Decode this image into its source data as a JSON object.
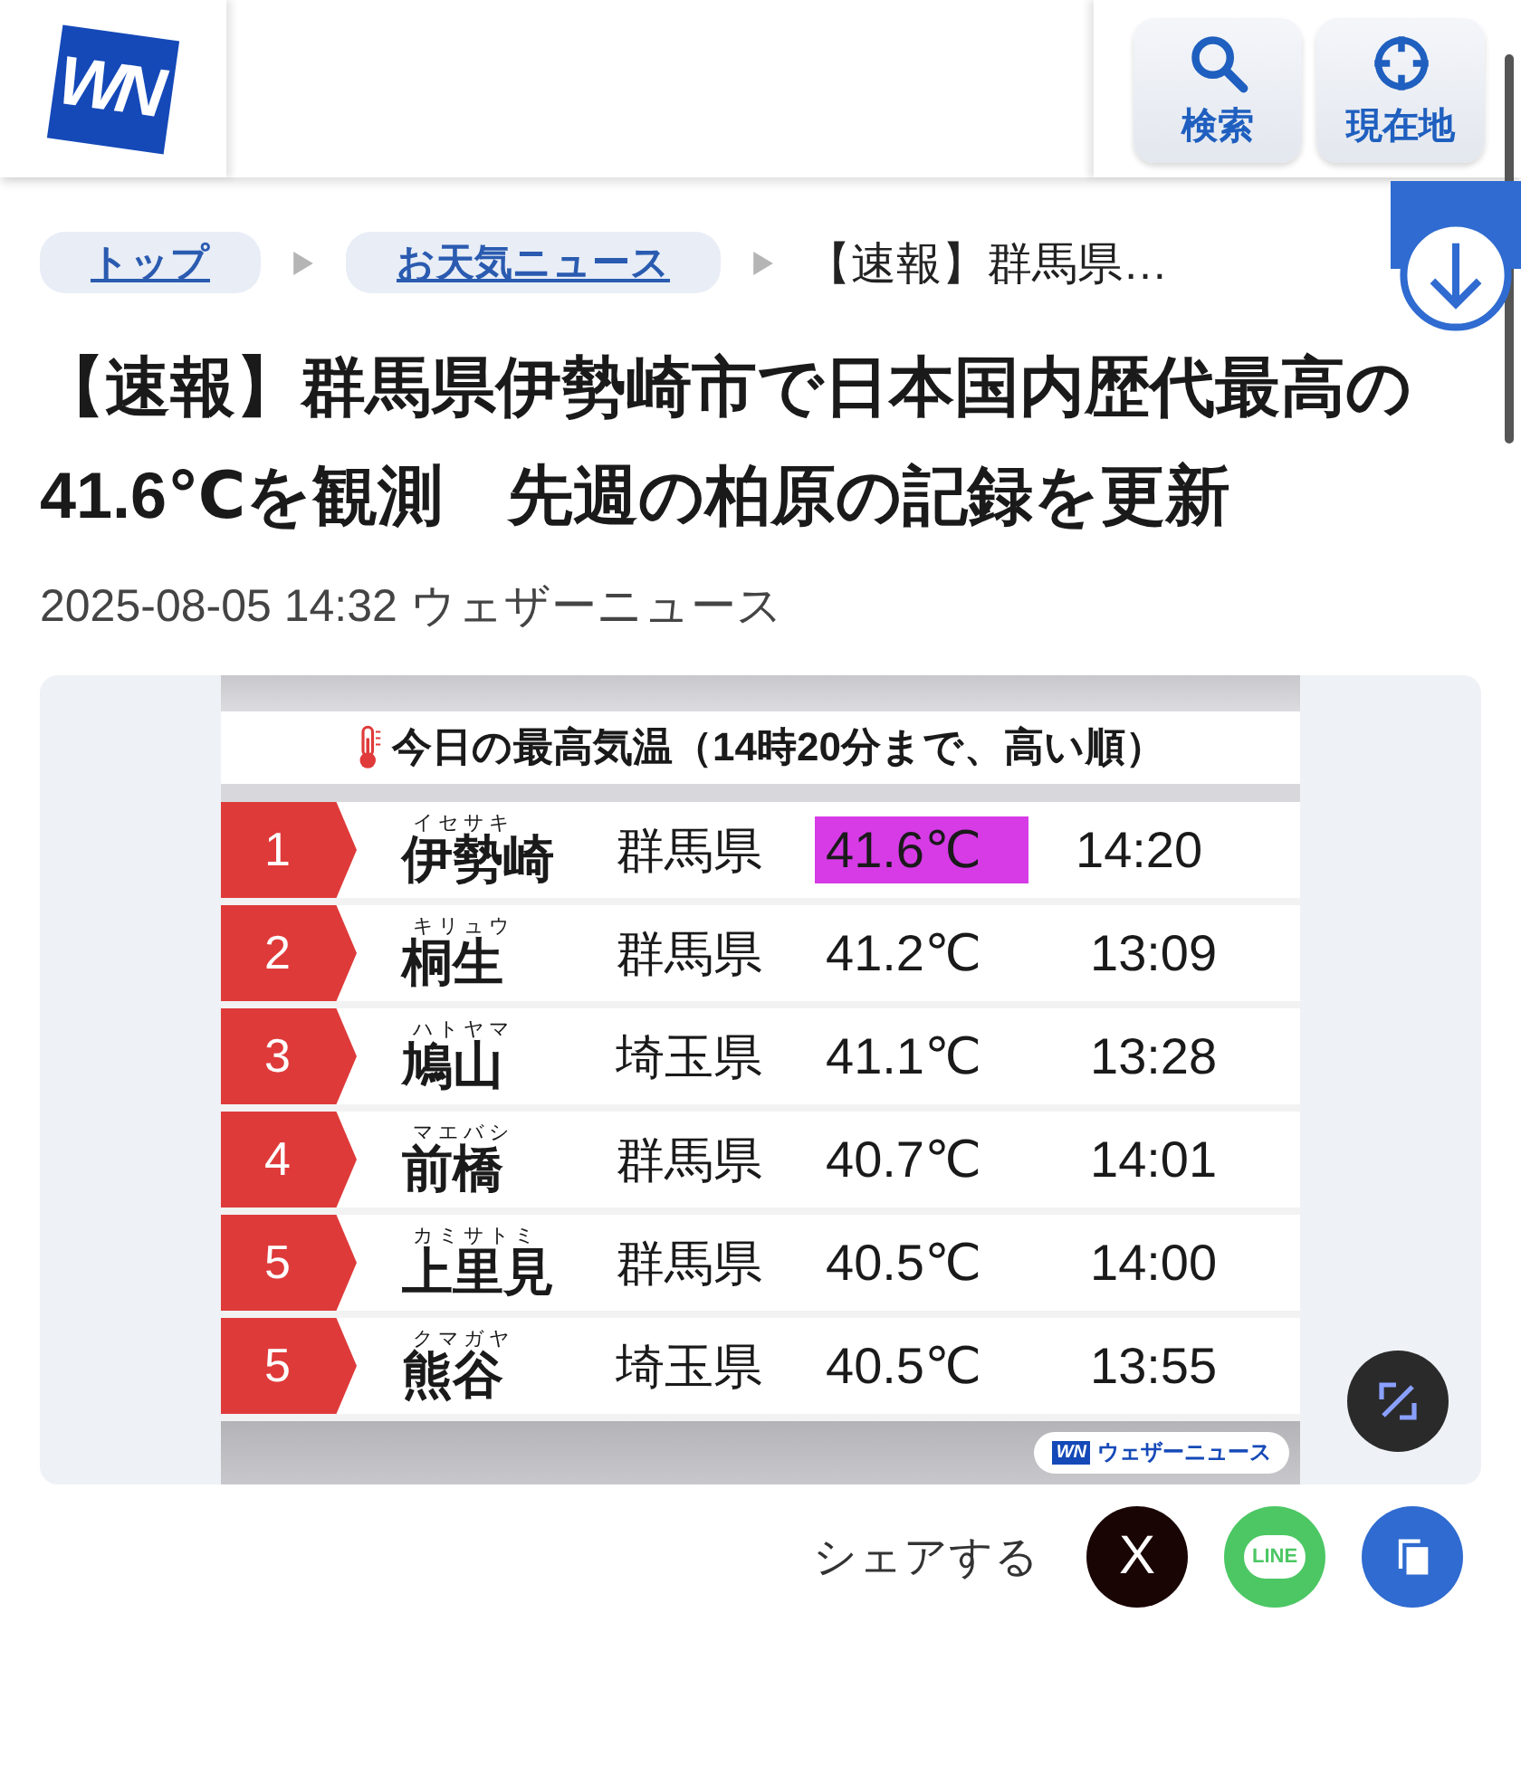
{
  "header": {
    "logo_text": "WN",
    "buttons": [
      {
        "kind": "search",
        "label": "検索"
      },
      {
        "kind": "location",
        "label": "現在地"
      }
    ]
  },
  "breadcrumb": [
    {
      "label": "トップ",
      "link": true
    },
    {
      "label": "お天気ニュース",
      "link": true
    },
    {
      "label": "【速報】群馬県…",
      "link": false
    }
  ],
  "article": {
    "title": "【速報】群馬県伊勢崎市で日本国内歴代最高の41.6℃を観測　先週の柏原の記録を更新",
    "meta": "2025-08-05 14:32 ウェザーニュース"
  },
  "figure": {
    "heading": "今日の最高気温（14時20分まで、高い順）",
    "rows": [
      {
        "rank": "1",
        "reading": "イセサキ",
        "name": "伊勢崎",
        "prefecture": "群馬県",
        "temperature": "41.6℃",
        "time": "14:20",
        "highlighted": true
      },
      {
        "rank": "2",
        "reading": "キリュウ",
        "name": "桐生",
        "prefecture": "群馬県",
        "temperature": "41.2℃",
        "time": "13:09",
        "highlighted": false
      },
      {
        "rank": "3",
        "reading": "ハトヤマ",
        "name": "鳩山",
        "prefecture": "埼玉県",
        "temperature": "41.1℃",
        "time": "13:28",
        "highlighted": false
      },
      {
        "rank": "4",
        "reading": "マエバシ",
        "name": "前橋",
        "prefecture": "群馬県",
        "temperature": "40.7℃",
        "time": "14:01",
        "highlighted": false
      },
      {
        "rank": "5",
        "reading": "カミサトミ",
        "name": "上里見",
        "prefecture": "群馬県",
        "temperature": "40.5℃",
        "time": "14:00",
        "highlighted": false
      },
      {
        "rank": "5",
        "reading": "クマガヤ",
        "name": "熊谷",
        "prefecture": "埼玉県",
        "temperature": "40.5℃",
        "time": "13:55",
        "highlighted": false
      }
    ],
    "credit_logo": "WN",
    "credit": "ウェザーニュース"
  },
  "share": {
    "label": "シェアする",
    "buttons": [
      {
        "kind": "x",
        "text": "X"
      },
      {
        "kind": "line",
        "text": "LINE"
      },
      {
        "kind": "copy"
      }
    ]
  }
}
